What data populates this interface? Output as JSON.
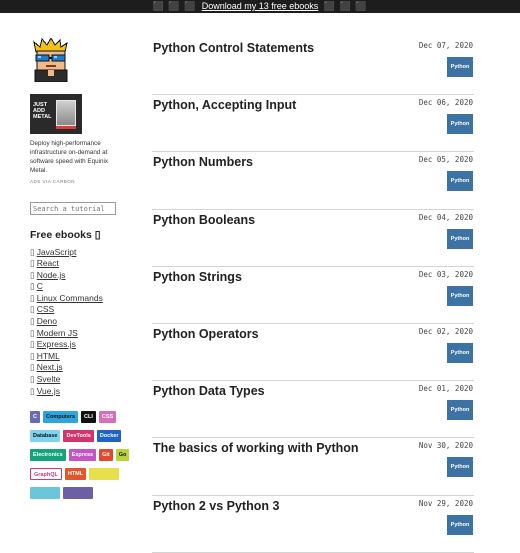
{
  "topbar": {
    "emoji_left": "⬛ ⬛ ⬛",
    "link": "Download my 13 free ebooks",
    "emoji_right": "⬛ ⬛ ⬛"
  },
  "sidebar": {
    "ad": {
      "image_text": "JUST ADD METAL",
      "text": "Deploy high-performance infrastructure on-demand at software speed with Equinix Metal.",
      "via": "ADS VIA CARBON"
    },
    "search": {
      "placeholder": "Search a tutorial"
    },
    "ebooks_title": "Free ebooks ▯",
    "ebooks": [
      {
        "bullet": "▯",
        "label": "JavaScript"
      },
      {
        "bullet": "▯",
        "label": "React"
      },
      {
        "bullet": "▯",
        "label": "Node.js"
      },
      {
        "bullet": "▯",
        "label": "C"
      },
      {
        "bullet": "▯",
        "label": "Linux Commands"
      },
      {
        "bullet": "▯",
        "label": "CSS"
      },
      {
        "bullet": "▯",
        "label": "Deno"
      },
      {
        "bullet": "▯",
        "label": "Modern JS"
      },
      {
        "bullet": "▯",
        "label": "Express.js"
      },
      {
        "bullet": "▯",
        "label": "HTML"
      },
      {
        "bullet": "▯",
        "label": "Next.js"
      },
      {
        "bullet": "▯",
        "label": "Svelte"
      },
      {
        "bullet": "▯",
        "label": "Vue.js"
      }
    ],
    "tags": [
      {
        "label": "C",
        "bg": "#6c6ab8",
        "fg": "#ffffff"
      },
      {
        "label": "Computers",
        "bg": "#2da6e0",
        "fg": "#111111"
      },
      {
        "label": "CLI",
        "bg": "#111111",
        "fg": "#ffffff"
      },
      {
        "label": "CSS",
        "bg": "#d56fb8",
        "fg": "#ffffff"
      },
      {
        "label": "Database",
        "bg": "#7ed4ee",
        "fg": "#111111"
      },
      {
        "label": "DevTools",
        "bg": "#d6336c",
        "fg": "#ffffff"
      },
      {
        "label": "Docker",
        "bg": "#1d63c9",
        "fg": "#ffffff"
      },
      {
        "label": "Electronics",
        "bg": "#14a37a",
        "fg": "#ffffff"
      },
      {
        "label": "Express",
        "bg": "#c455c4",
        "fg": "#ffffff"
      },
      {
        "label": "Git",
        "bg": "#e04a2f",
        "fg": "#ffffff"
      },
      {
        "label": "Go",
        "bg": "#b9d33a",
        "fg": "#111111"
      },
      {
        "label": "GraphQL",
        "bg": "#ffffff",
        "fg": "#d6337f",
        "border": "#d6337f"
      },
      {
        "label": "HTML",
        "bg": "#e8542a",
        "fg": "#ffffff"
      },
      {
        "label": "",
        "bg": "#e8e04a",
        "fg": "#111111"
      },
      {
        "label": "",
        "bg": "#6ac6d8",
        "fg": "#111111"
      },
      {
        "label": "",
        "bg": "#6c5fa6",
        "fg": "#ffffff"
      }
    ]
  },
  "posts": [
    {
      "title": "Python Control Statements",
      "date": "Dec 07, 2020",
      "tag": "Python"
    },
    {
      "title": "Python, Accepting Input",
      "date": "Dec 06, 2020",
      "tag": "Python"
    },
    {
      "title": "Python Numbers",
      "date": "Dec 05, 2020",
      "tag": "Python"
    },
    {
      "title": "Python Booleans",
      "date": "Dec 04, 2020",
      "tag": "Python"
    },
    {
      "title": "Python Strings",
      "date": "Dec 03, 2020",
      "tag": "Python"
    },
    {
      "title": "Python Operators",
      "date": "Dec 02, 2020",
      "tag": "Python"
    },
    {
      "title": "Python Data Types",
      "date": "Dec 01, 2020",
      "tag": "Python"
    },
    {
      "title": "The basics of working with Python",
      "date": "Nov 30, 2020",
      "tag": "Python"
    },
    {
      "title": "Python 2 vs Python 3",
      "date": "Nov 29, 2020",
      "tag": "Python"
    }
  ],
  "colors": {
    "topbar": "#1d1d1d",
    "python_badge": "#3d72a4",
    "divider": "#d4d4d4"
  }
}
